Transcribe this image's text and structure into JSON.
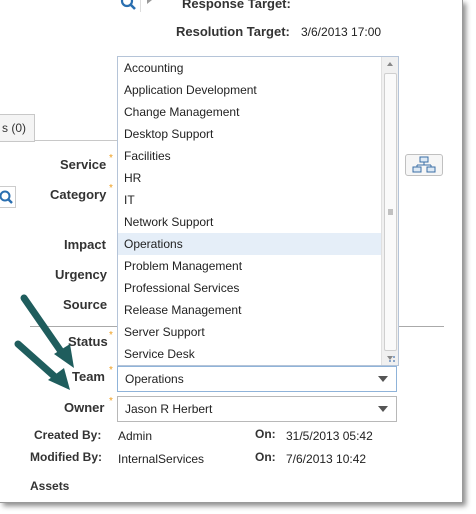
{
  "header": {
    "response_target_label": "Response Target:",
    "resolution_target_label": "Resolution Target:",
    "resolution_target_value": "3/6/2013 17:00"
  },
  "tab": {
    "label": "s (0)"
  },
  "fields": {
    "service_label": "Service",
    "category_label": "Category",
    "impact_label": "Impact",
    "urgency_label": "Urgency",
    "source_label": "Source",
    "status_label": "Status",
    "team_label": "Team",
    "owner_label": "Owner",
    "required_mark": "*"
  },
  "team_dropdown": {
    "selected": "Operations",
    "options": [
      "Accounting",
      "Application Development",
      "Change Management",
      "Desktop Support",
      "Facilities",
      "HR",
      "IT",
      "Network Support",
      "Operations",
      "Problem Management",
      "Professional Services",
      "Release Management",
      "Server Support",
      "Service Desk"
    ]
  },
  "owner_dropdown": {
    "selected": "Jason R Herbert"
  },
  "meta": {
    "created_by_label": "Created By:",
    "created_by_value": "Admin",
    "created_on_label": "On:",
    "created_on_value": "31/5/2013 05:42",
    "modified_by_label": "Modified By:",
    "modified_by_value": "InternalServices",
    "modified_on_label": "On:",
    "modified_on_value": "7/6/2013 10:42",
    "assets_label": "Assets"
  },
  "colors": {
    "required": "#f0a020",
    "search_icon": "#2a6fb0",
    "arrow": "#1f5d5d",
    "selected_row": "#e5eef8"
  },
  "icons": [
    "search-icon",
    "play-icon",
    "hierarchy-icon",
    "dropdown-arrow-icon",
    "resize-grip-icon"
  ]
}
